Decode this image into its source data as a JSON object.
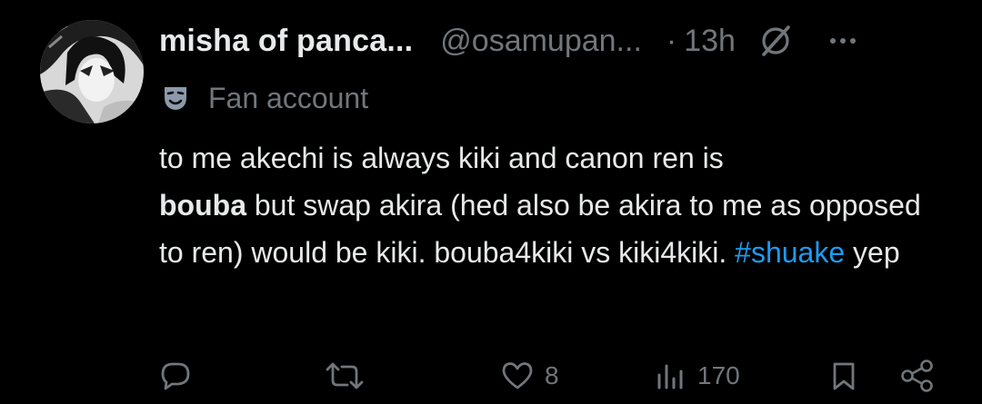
{
  "tweet": {
    "display_name": "misha of panca...",
    "handle": "@osamupan...",
    "separator": "·",
    "time": "13h",
    "label": "Fan account",
    "text_1": "to me akechi is always kiki and canon ren is",
    "text_bold": "bouba",
    "text_2": " but swap akira (hed also be akira to me as opposed to ren) would be kiki. bouba4kiki vs kiki4kiki. ",
    "hashtag": "#shuake",
    "text_3": " yep"
  },
  "actions": {
    "likes": "8",
    "views": "170"
  },
  "icons": {
    "grok": "grok-icon",
    "more": "more-icon",
    "label": "theater-mask-icon",
    "reply": "reply-icon",
    "repost": "repost-icon",
    "like": "heart-icon",
    "views": "views-icon",
    "bookmark": "bookmark-icon",
    "share": "share-icon"
  },
  "colors": {
    "background": "#000000",
    "text": "#e7e9ea",
    "muted": "#71767b",
    "link": "#1d9bf0",
    "label_icon": "#8a9aab"
  }
}
